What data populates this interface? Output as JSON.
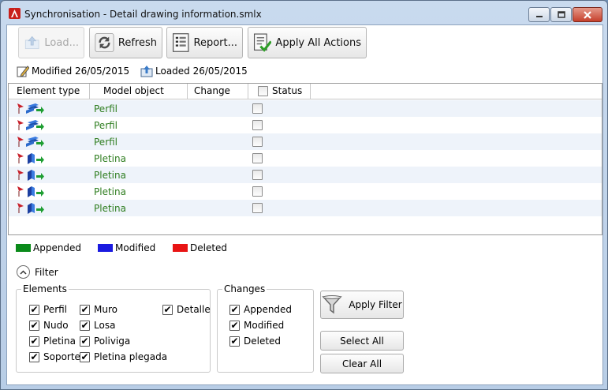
{
  "window": {
    "title": "Synchronisation - Detail drawing information.smlx"
  },
  "toolbar": {
    "load_label": "Load...",
    "refresh_label": "Refresh",
    "report_label": "Report...",
    "apply_all_label": "Apply All Actions"
  },
  "info": {
    "modified": "Modified 26/05/2015",
    "loaded": "Loaded 26/05/2015"
  },
  "grid": {
    "columns": [
      "Element type",
      "Model object",
      "Change",
      "Status"
    ],
    "rows": [
      {
        "icon": "beam-append-icon",
        "object": "Perfil"
      },
      {
        "icon": "beam-append-icon",
        "object": "Perfil"
      },
      {
        "icon": "beam-append-icon",
        "object": "Perfil"
      },
      {
        "icon": "plate-append-icon",
        "object": "Pletina"
      },
      {
        "icon": "plate-append-icon",
        "object": "Pletina"
      },
      {
        "icon": "plate-append-icon",
        "object": "Pletina"
      },
      {
        "icon": "plate-append-icon",
        "object": "Pletina"
      }
    ]
  },
  "legend": [
    {
      "label": "Appended",
      "color": "#0a8a1a"
    },
    {
      "label": "Modified",
      "color": "#1a1ae0"
    },
    {
      "label": "Deleted",
      "color": "#e81414"
    }
  ],
  "filter": {
    "label": "Filter",
    "elements_title": "Elements",
    "elements": [
      "Perfil",
      "Nudo",
      "Pletina",
      "Soporte",
      "Muro",
      "Losa",
      "Poliviga",
      "Pletina plegada",
      "Detalle"
    ],
    "changes_title": "Changes",
    "changes": [
      "Appended",
      "Modified",
      "Deleted"
    ],
    "apply_filter_label": "Apply Filter",
    "select_all_label": "Select All",
    "clear_all_label": "Clear All"
  }
}
